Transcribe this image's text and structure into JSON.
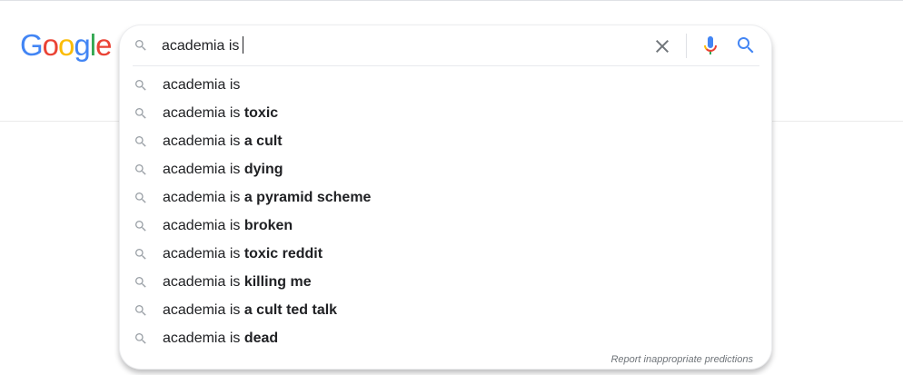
{
  "logo": {
    "letters": [
      "G",
      "o",
      "o",
      "g",
      "l",
      "e"
    ],
    "colors": [
      "#4285F4",
      "#EA4335",
      "#FBBC05",
      "#4285F4",
      "#34A853",
      "#EA4335"
    ]
  },
  "search": {
    "query": "academia is",
    "clear_icon": "close-icon",
    "mic_icon": "microphone-icon",
    "submit_icon": "search-icon"
  },
  "suggestions": [
    {
      "prefix": "academia is",
      "completion": ""
    },
    {
      "prefix": "academia is ",
      "completion": "toxic"
    },
    {
      "prefix": "academia is ",
      "completion": "a cult"
    },
    {
      "prefix": "academia is ",
      "completion": "dying"
    },
    {
      "prefix": "academia is ",
      "completion": "a pyramid scheme"
    },
    {
      "prefix": "academia is ",
      "completion": "broken"
    },
    {
      "prefix": "academia is ",
      "completion": "toxic reddit"
    },
    {
      "prefix": "academia is ",
      "completion": "killing me"
    },
    {
      "prefix": "academia is ",
      "completion": "a cult ted talk"
    },
    {
      "prefix": "academia is ",
      "completion": "dead"
    }
  ],
  "footer": {
    "report_label": "Report inappropriate predictions"
  },
  "colors": {
    "accent_blue": "#4285F4",
    "text": "#202124",
    "icon_gray": "#9aa0a6",
    "muted": "#70757a"
  }
}
